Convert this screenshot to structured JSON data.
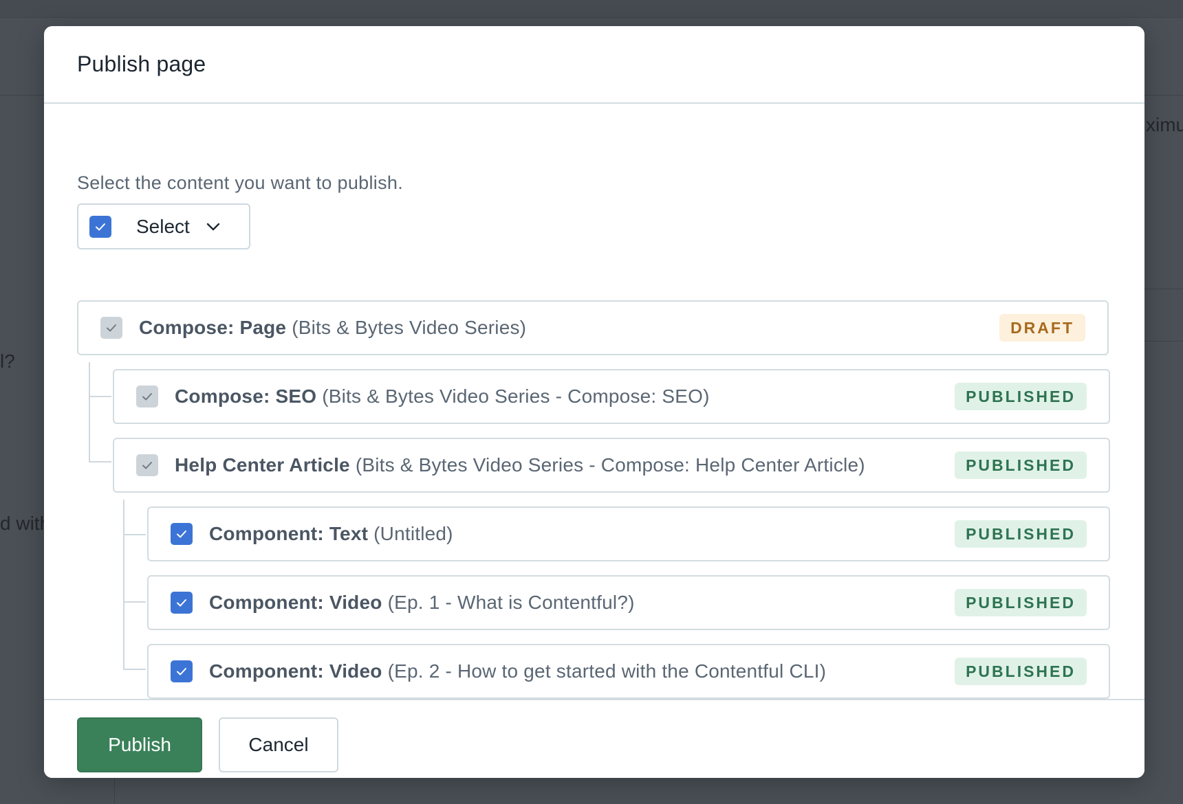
{
  "background": {
    "fragments": [
      "ximu",
      "l?",
      "d with"
    ]
  },
  "modal": {
    "title": "Publish page",
    "intro": "Select the content you want to publish.",
    "select_control": {
      "label": "Select",
      "checked": true
    },
    "items": [
      {
        "type": "Compose: Page",
        "name": "(Bits & Bytes Video Series)",
        "status": "DRAFT",
        "checkbox": "disabled-checked",
        "level": 0
      },
      {
        "type": "Compose: SEO",
        "name": "(Bits & Bytes Video Series - Compose: SEO)",
        "status": "PUBLISHED",
        "checkbox": "disabled-checked",
        "level": 1
      },
      {
        "type": "Help Center Article",
        "name": "(Bits & Bytes Video Series - Compose: Help Center Article)",
        "status": "PUBLISHED",
        "checkbox": "disabled-checked",
        "level": 1
      },
      {
        "type": "Component: Text",
        "name": "(Untitled)",
        "status": "PUBLISHED",
        "checkbox": "checked",
        "level": 2
      },
      {
        "type": "Component: Video",
        "name": "(Ep. 1 - What is Contentful?)",
        "status": "PUBLISHED",
        "checkbox": "checked",
        "level": 2
      },
      {
        "type": "Component: Video",
        "name": "(Ep. 2 - How to get started with the Contentful CLI)",
        "status": "PUBLISHED",
        "checkbox": "checked",
        "level": 2
      }
    ],
    "buttons": {
      "publish": "Publish",
      "cancel": "Cancel"
    }
  },
  "colors": {
    "checkbox_checked": "#3c74d6",
    "checkbox_disabled": "#cdd4d9",
    "primary_button": "#3a8159",
    "draft_badge_bg": "#fdf0dc",
    "draft_badge_text": "#a66a1e",
    "published_badge_bg": "#e0f2e7",
    "published_badge_text": "#2e7352",
    "overlay": "#4a5056"
  }
}
